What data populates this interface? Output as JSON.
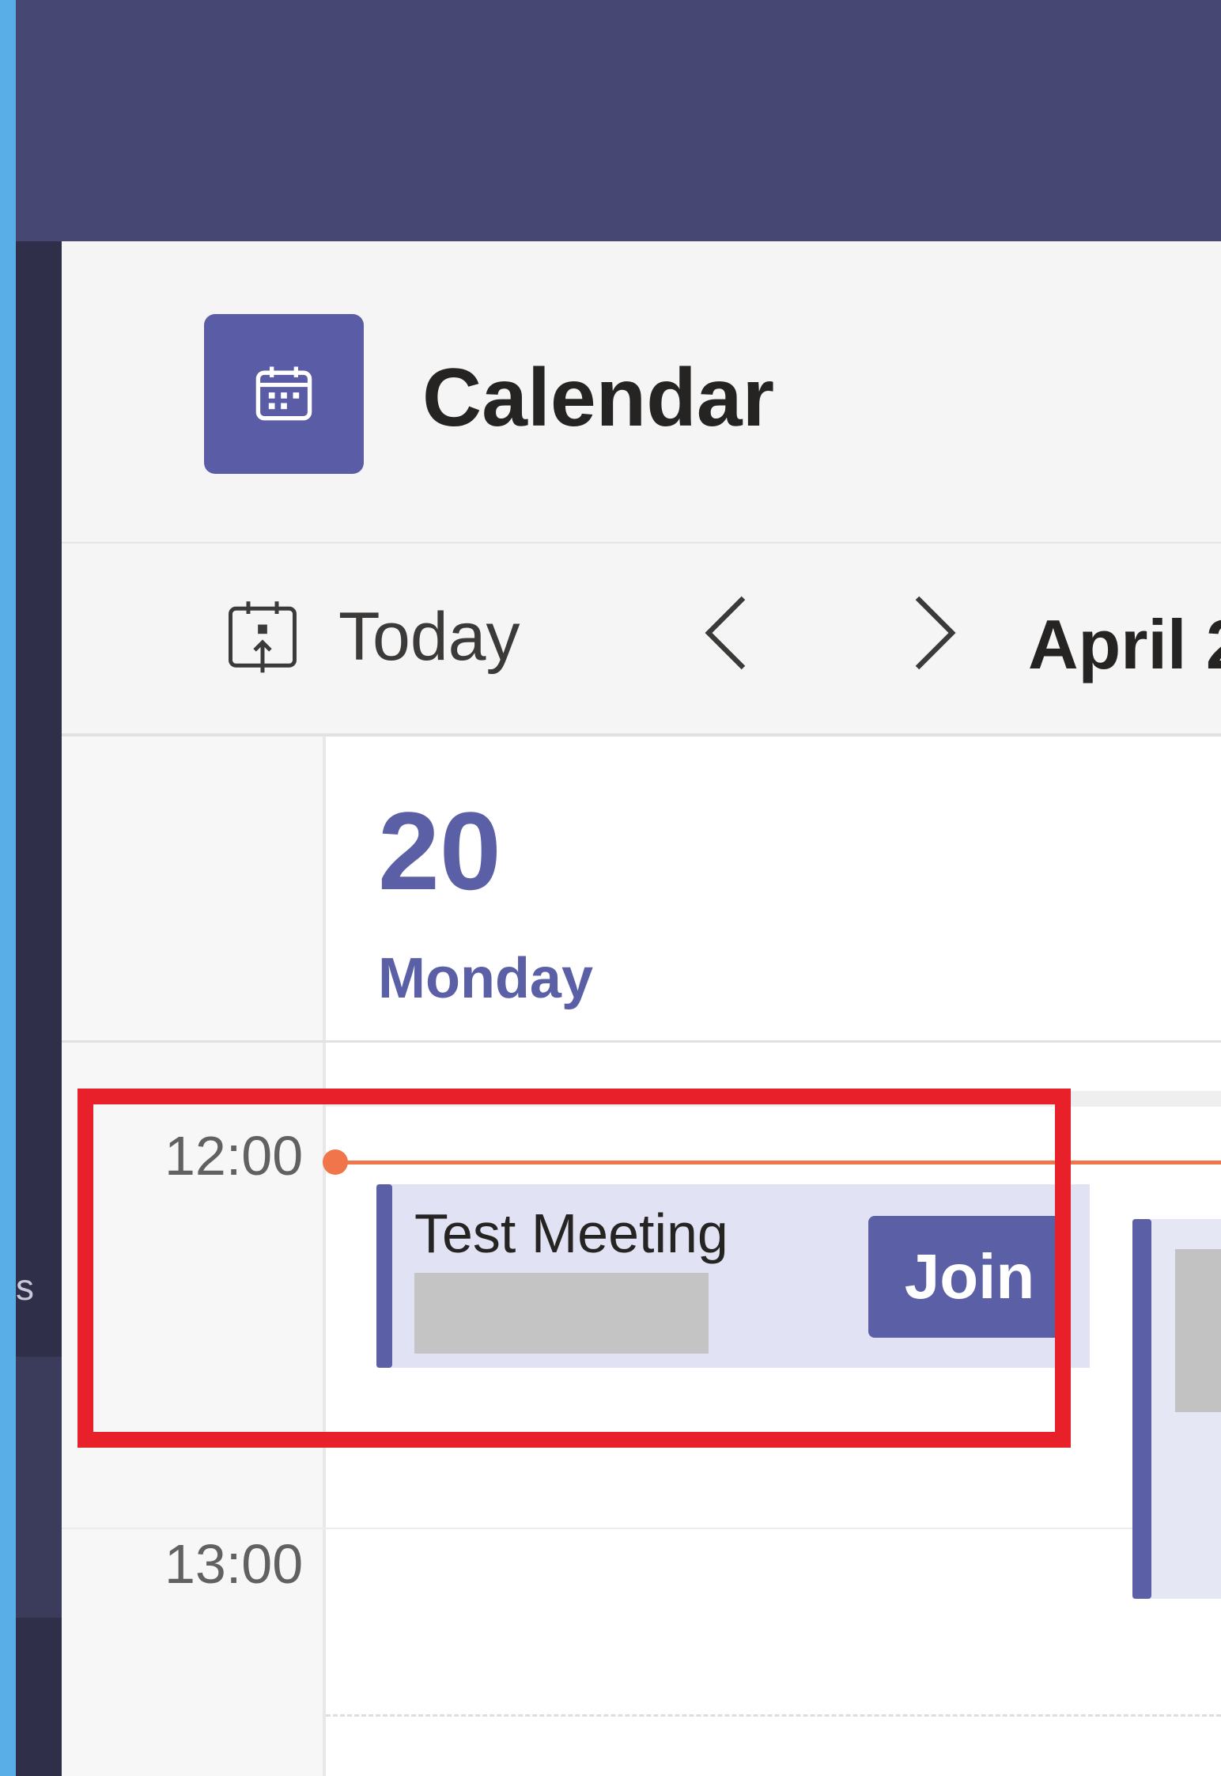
{
  "header": {
    "title": "Calendar",
    "app_icon": "calendar-icon"
  },
  "toolbar": {
    "today_label": "Today",
    "today_icon": "calendar-today-icon",
    "prev_icon": "chevron-left-icon",
    "next_icon": "chevron-right-icon",
    "month_label": "April 2"
  },
  "day": {
    "number": "20",
    "name": "Monday"
  },
  "times": [
    "12:00",
    "13:00"
  ],
  "event": {
    "title": "Test Meeting",
    "join_label": "Join"
  },
  "rail": {
    "partial_label": "s"
  },
  "colors": {
    "title_bar": "#474774",
    "brand_purple": "#5b5fa6",
    "event_bg": "#e1e3f5",
    "now_line": "#f0754a",
    "highlight": "#e8202a",
    "outer_border": "#5aaee8"
  }
}
